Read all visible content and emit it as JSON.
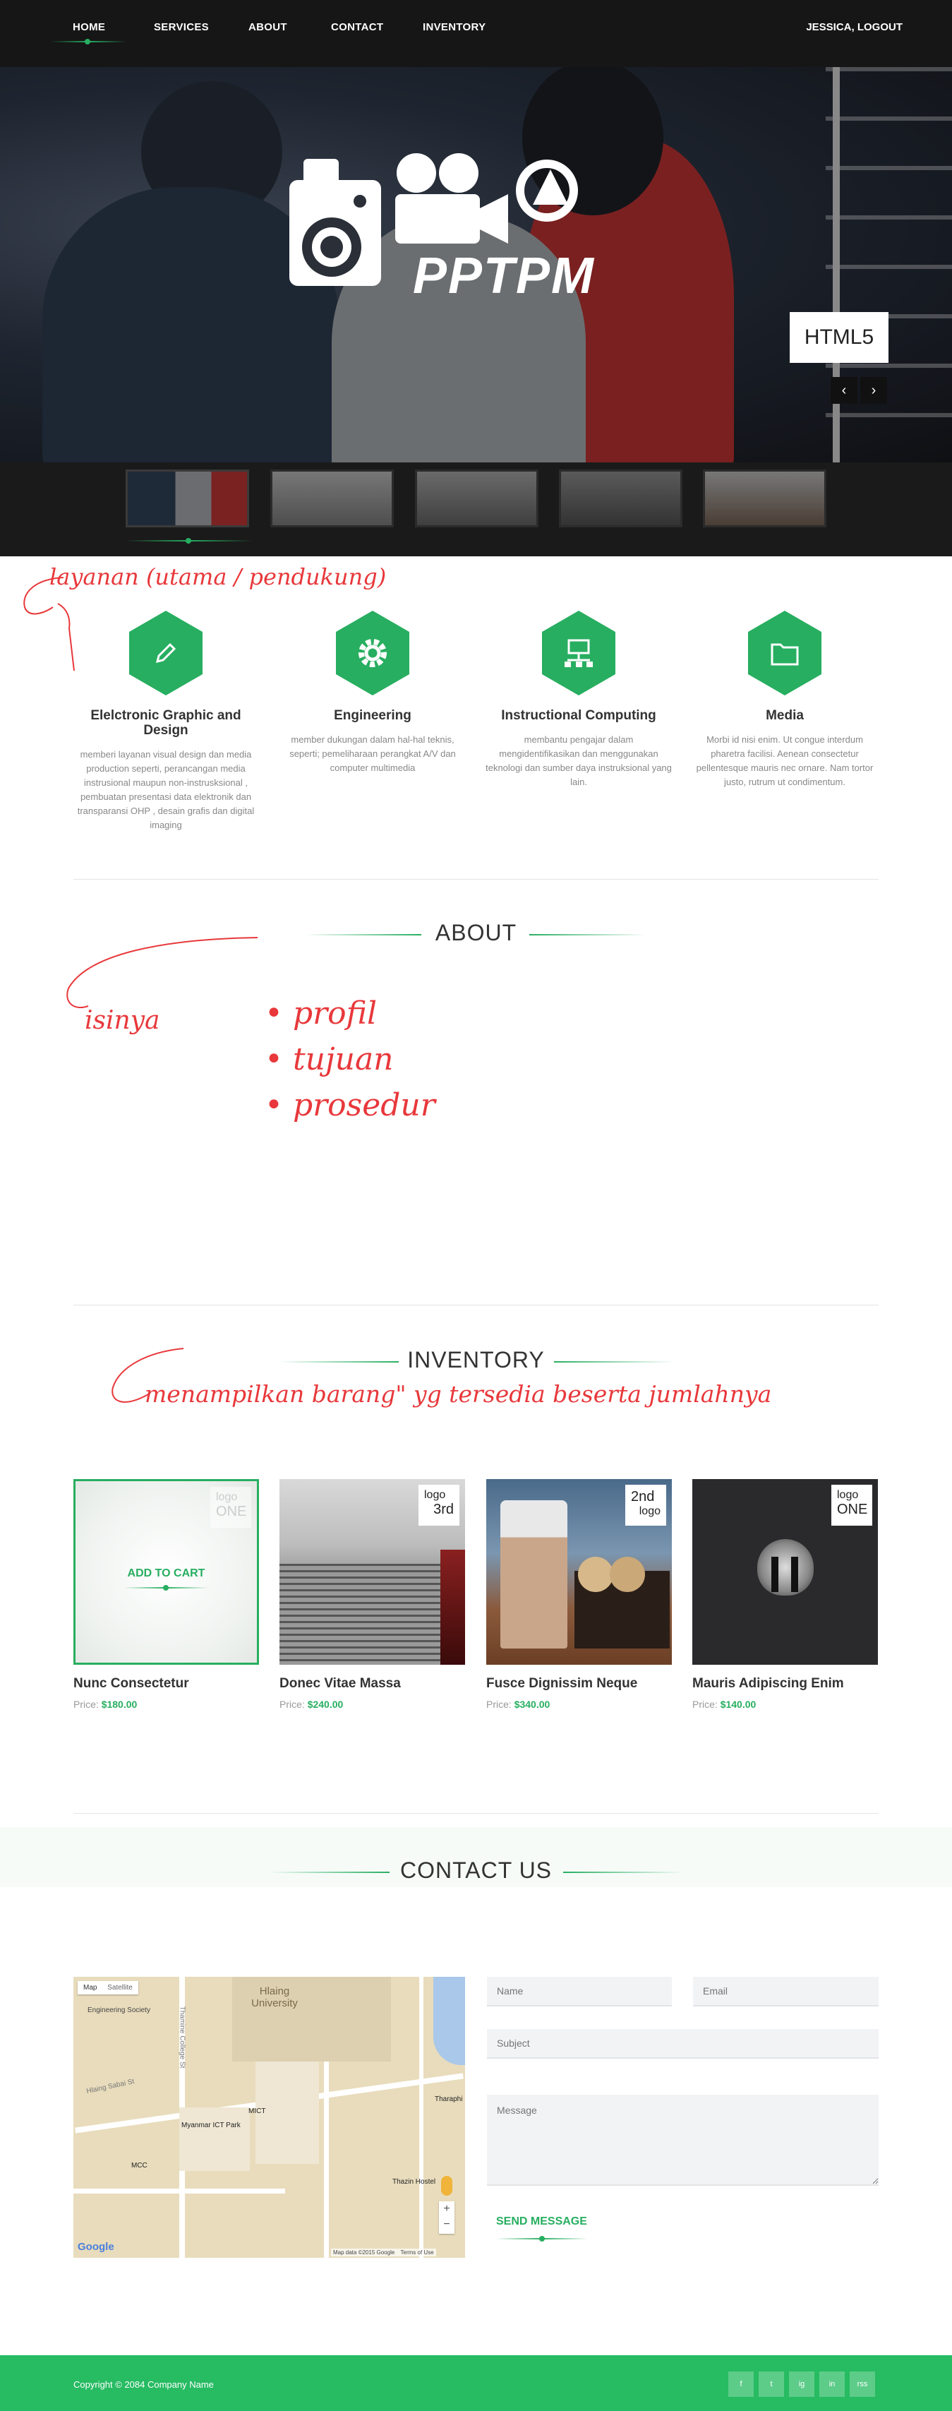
{
  "nav": {
    "items": [
      "HOME",
      "SERVICES",
      "ABOUT",
      "CONTACT",
      "INVENTORY"
    ],
    "user_label": "JESSICA, LOGOUT"
  },
  "hero": {
    "logo_text": "PPTPM",
    "badge": "HTML5"
  },
  "annotations": {
    "services_note": "layanan (utama / pendukung)",
    "about_note": "isinya",
    "about_items": [
      "profil",
      "tujuan",
      "prosedur"
    ],
    "inventory_note": "menampilkan barang\" yg tersedia beserta jumlahnya"
  },
  "services": [
    {
      "icon": "pencil-icon",
      "title": "Elelctronic Graphic and Design",
      "desc": "memberi layanan visual design dan media production seperti, perancangan media instrusional maupun non-instrusksional , pembuatan presentasi data elektronik dan transparansi OHP , desain grafis dan digital imaging"
    },
    {
      "icon": "gear-icon",
      "title": "Engineering",
      "desc": "member dukungan dalam hal-hal teknis, seperti; pemeliharaan perangkat A/V dan computer multimedia"
    },
    {
      "icon": "network-icon",
      "title": "Instructional Computing",
      "desc": "membantu pengajar dalam mengidentifikasikan dan menggunakan teknologi dan sumber daya instruksional yang lain."
    },
    {
      "icon": "folder-icon",
      "title": "Media",
      "desc": "Morbi id nisi enim. Ut congue interdum pharetra facilisi. Aenean consectetur pellentesque mauris nec ornare. Nam tortor justo, rutrum ut condimentum."
    }
  ],
  "about": {
    "title": "ABOUT"
  },
  "inventory": {
    "title": "INVENTORY",
    "add_to_cart": "ADD TO CART",
    "price_label": "Price:",
    "products": [
      {
        "name": "Nunc Consectetur",
        "price": "$180.00",
        "tag_top": "logo",
        "tag_bottom": "ONE"
      },
      {
        "name": "Donec Vitae Massa",
        "price": "$240.00",
        "tag_top": "logo",
        "tag_bottom": "3rd"
      },
      {
        "name": "Fusce Dignissim Neque",
        "price": "$340.00",
        "tag_top": "2nd",
        "tag_bottom": "logo"
      },
      {
        "name": "Mauris Adipiscing Enim",
        "price": "$140.00",
        "tag_top": "logo",
        "tag_bottom": "ONE"
      }
    ]
  },
  "contact": {
    "title": "CONTACT US",
    "name_placeholder": "Name",
    "email_placeholder": "Email",
    "subject_placeholder": "Subject",
    "message_placeholder": "Message",
    "send_label": "SEND MESSAGE"
  },
  "map": {
    "tab_map": "Map",
    "tab_satellite": "Satellite",
    "labels": [
      "Hlaing University",
      "Engineering Society",
      "Myanmar ICT Park",
      "MICT",
      "MCC",
      "Thazin Hostel",
      "Hlaing Sabai St",
      "Thamine College St",
      "Tharaphi"
    ],
    "footer_text": "Map data ©2015 Google",
    "terms": "Terms of Use",
    "google": "Google"
  },
  "footer": {
    "copyright": "Copyright © 2084 Company Name",
    "social": [
      "f",
      "t",
      "ig",
      "in",
      "rss"
    ]
  }
}
